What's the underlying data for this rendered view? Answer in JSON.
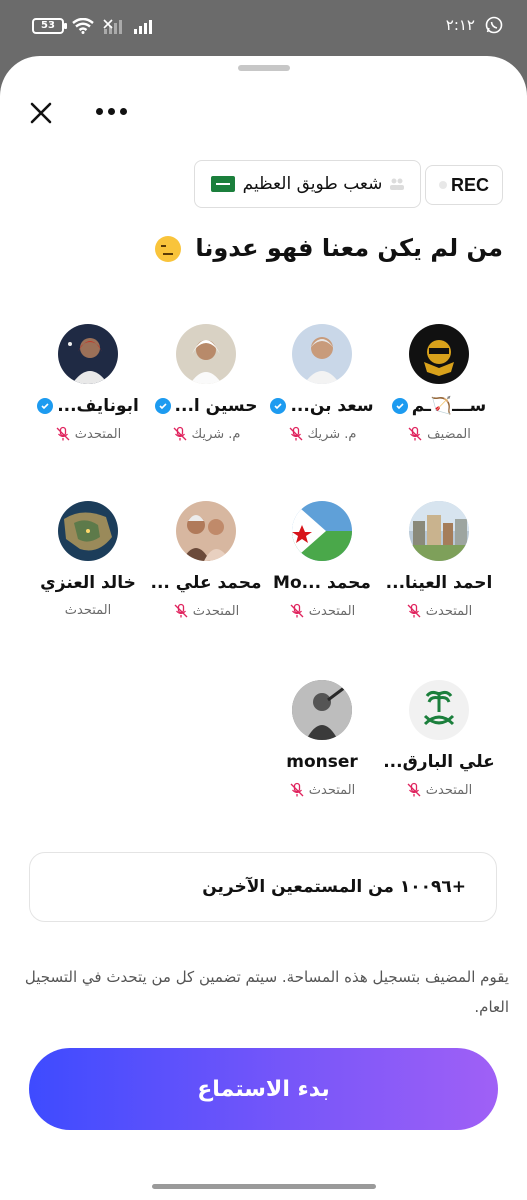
{
  "status_bar": {
    "battery": "53",
    "time": "٢:١٢",
    "icons": [
      "whatsapp-icon",
      "wifi-icon",
      "signal-off-icon",
      "signal-icon"
    ]
  },
  "header": {
    "close_icon": "close-icon",
    "more_icon": "more-icon",
    "rec_label": "REC",
    "community_label": "شعب طويق العظيم"
  },
  "space_title": "من لم يكن معنا فهو عدونا",
  "speakers": [
    {
      "name": "ســـ🏹ـم",
      "role": "المضيف",
      "verified": true,
      "avatar_bg": "#111111"
    },
    {
      "name": "سعد بن...",
      "role": "م. شريك",
      "verified": true,
      "avatar_bg": "#c9d7e8"
    },
    {
      "name": "حسين ا...",
      "role": "م. شريك",
      "verified": true,
      "avatar_bg": "#d9d2c4"
    },
    {
      "name": "ابونايف...",
      "role": "المتحدث",
      "verified": true,
      "avatar_bg": "#1f2a44"
    },
    {
      "name": "احمد العينا...",
      "role": "المتحدث",
      "verified": false,
      "avatar_bg": "#b9c9d6"
    },
    {
      "name": "محمد ...Mo",
      "role": "المتحدث",
      "verified": false,
      "avatar_bg": "#5fa0d8"
    },
    {
      "name": "محمد علي ...",
      "role": "المتحدث",
      "verified": false,
      "avatar_bg": "#d7b7a0"
    },
    {
      "name": "خالد العنزي",
      "role": "المتحدث",
      "verified": false,
      "avatar_bg": "#1c3d5a"
    },
    {
      "name": "علي البارق...",
      "role": "المتحدث",
      "verified": false,
      "avatar_bg": "#f1f1f1"
    },
    {
      "name": "monser",
      "role": "المتحدث",
      "verified": false,
      "avatar_bg": "#777777"
    }
  ],
  "listeners_label": "+١٠٠٩٦ من المستمعين الآخرين",
  "recording_notice": "يقوم المضيف بتسجيل هذه المساحة. سيتم تضمين كل من يتحدث في التسجيل العام.",
  "listen_button_label": "بدء الاستماع"
}
